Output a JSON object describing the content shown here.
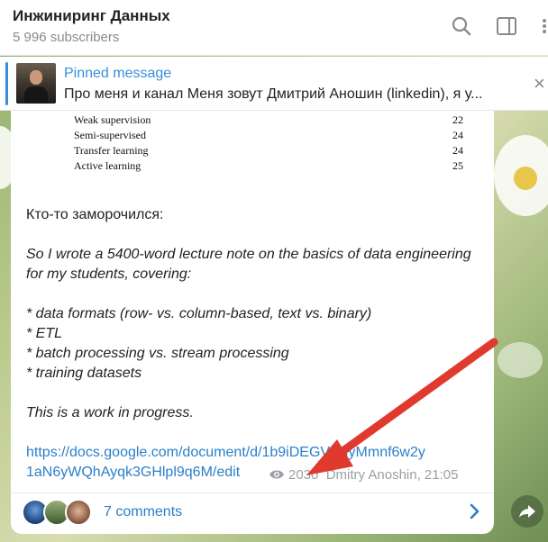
{
  "channel": {
    "title": "Инжиниринг Данных",
    "subscribers": "5 996 subscribers"
  },
  "header_icons": [
    "search-icon",
    "sidebar-toggle-icon"
  ],
  "pinned": {
    "label": "Pinned message",
    "text": "Про меня и канал Меня зовут Дмитрий Аношин (linkedin), я у..."
  },
  "post": {
    "toc": [
      {
        "title": "Weak supervision",
        "page": "22"
      },
      {
        "title": "Semi-supervised",
        "page": "24"
      },
      {
        "title": "Transfer learning",
        "page": "24"
      },
      {
        "title": "Active learning",
        "page": "25"
      }
    ],
    "intro": "Кто-то заморочился:",
    "quote_lines": [
      "So I wrote a 5400-word lecture note on the basics of data engineering",
      "for my students, covering:"
    ],
    "bullets": [
      "* data formats (row- vs. column-based, text vs. binary)",
      "* ETL",
      "* batch processing vs. stream processing",
      "* training datasets"
    ],
    "closing": "This is a work in progress.",
    "link_line1": "https://docs.google.com/document/d/1b9iDEGVLHyMmnf6w2y",
    "link_line2": "1aN6yWQhAyqk3GHlpl9q6M/edit",
    "views": "2030",
    "author_time": "Dmitry Anoshin, 21:05",
    "accent_link": "#2a7fc9",
    "annotation_arrow_color": "#e03a2f"
  },
  "comments": {
    "label": "7 comments"
  }
}
